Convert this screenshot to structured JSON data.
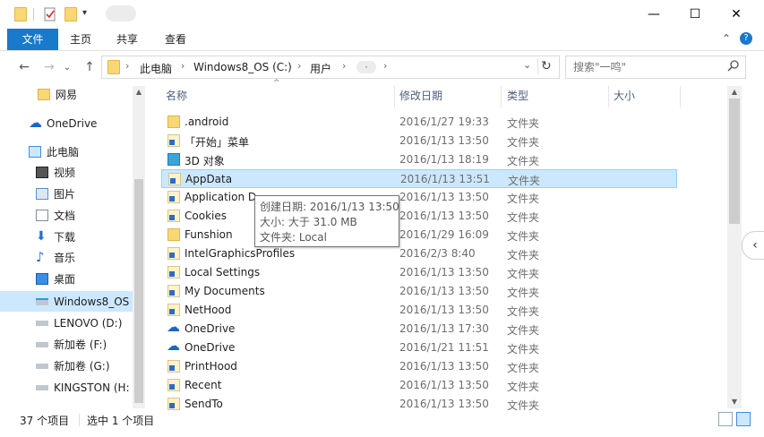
{
  "window": {
    "minimize_glyph": "—",
    "maximize_glyph": "☐",
    "close_glyph": "✕"
  },
  "ribbon": {
    "tabs": [
      {
        "label": "文件"
      },
      {
        "label": "主页"
      },
      {
        "label": "共享"
      },
      {
        "label": "查看"
      }
    ],
    "collapse_glyph": "⌃",
    "help_glyph": "?"
  },
  "nav_buttons": {
    "back": "←",
    "forward": "→",
    "recent": "⌄",
    "up": "↑"
  },
  "address": {
    "crumbs": [
      "此电脑",
      "Windows8_OS (C:)",
      "用户",
      "·"
    ],
    "refresh_glyph": "↻",
    "dropdown_glyph": "⌄"
  },
  "search": {
    "placeholder": "搜索\"一鸣\"",
    "icon": "search-icon"
  },
  "nav_pane": {
    "items": [
      {
        "label": "网易",
        "icon": "folder-icon"
      },
      {
        "label": "OneDrive",
        "icon": "onedrive-icon"
      },
      {
        "label": "此电脑",
        "icon": "pc-icon"
      },
      {
        "label": "视频",
        "icon": "video-icon"
      },
      {
        "label": "图片",
        "icon": "pictures-icon"
      },
      {
        "label": "文档",
        "icon": "documents-icon"
      },
      {
        "label": "下载",
        "icon": "download-icon"
      },
      {
        "label": "音乐",
        "icon": "music-icon"
      },
      {
        "label": "桌面",
        "icon": "desktop-icon"
      },
      {
        "label": "Windows8_OS",
        "icon": "drive-icon",
        "selected": true
      },
      {
        "label": "LENOVO (D:)",
        "icon": "drive-icon"
      },
      {
        "label": "新加卷 (F:)",
        "icon": "drive-icon"
      },
      {
        "label": "新加卷 (G:)",
        "icon": "drive-icon"
      },
      {
        "label": "KINGSTON (H:",
        "icon": "usb-drive-icon"
      }
    ]
  },
  "list": {
    "columns": {
      "name": "名称",
      "date": "修改日期",
      "type": "类型",
      "size": "大小"
    },
    "sort_glyph": "^",
    "rows": [
      {
        "name": ".android",
        "date": "2016/1/27 19:33",
        "type": "文件夹",
        "icon": "folder"
      },
      {
        "name": "「开始」菜单",
        "date": "2016/1/13 13:50",
        "type": "文件夹",
        "icon": "shortcut"
      },
      {
        "name": "3D 对象",
        "date": "2016/1/13 18:19",
        "type": "文件夹",
        "icon": "3d"
      },
      {
        "name": "AppData",
        "date": "2016/1/13 13:51",
        "type": "文件夹",
        "icon": "folder-light",
        "selected": true
      },
      {
        "name": "Application D",
        "date": "2016/1/13 13:50",
        "type": "文件夹",
        "icon": "shortcut"
      },
      {
        "name": "Cookies",
        "date": "2016/1/13 13:50",
        "type": "文件夹",
        "icon": "shortcut"
      },
      {
        "name": "Funshion",
        "date": "2016/1/29 16:09",
        "type": "文件夹",
        "icon": "folder"
      },
      {
        "name": "IntelGraphicsProfiles",
        "date": "2016/2/3 8:40",
        "type": "文件夹",
        "icon": "folder-light"
      },
      {
        "name": "Local Settings",
        "date": "2016/1/13 13:50",
        "type": "文件夹",
        "icon": "shortcut"
      },
      {
        "name": "My Documents",
        "date": "2016/1/13 13:50",
        "type": "文件夹",
        "icon": "shortcut"
      },
      {
        "name": "NetHood",
        "date": "2016/1/13 13:50",
        "type": "文件夹",
        "icon": "shortcut"
      },
      {
        "name": "OneDrive",
        "date": "2016/1/13 17:30",
        "type": "文件夹",
        "icon": "cloud"
      },
      {
        "name": "OneDrive",
        "date": "2016/1/21 11:51",
        "type": "文件夹",
        "icon": "cloud"
      },
      {
        "name": "PrintHood",
        "date": "2016/1/13 13:50",
        "type": "文件夹",
        "icon": "shortcut"
      },
      {
        "name": "Recent",
        "date": "2016/1/13 13:50",
        "type": "文件夹",
        "icon": "shortcut"
      },
      {
        "name": "SendTo",
        "date": "2016/1/13 13:50",
        "type": "文件夹",
        "icon": "shortcut"
      }
    ]
  },
  "tooltip": {
    "line1": "创建日期: 2016/1/13 13:50",
    "line2": "大小: 大于 31.0 MB",
    "line3": "文件夹: Local"
  },
  "status_bar": {
    "item_count": "37 个项目",
    "selection": "选中 1 个项目"
  },
  "colors": {
    "accent": "#1979ca",
    "selection": "#cce8ff",
    "folder": "#f8d775"
  }
}
